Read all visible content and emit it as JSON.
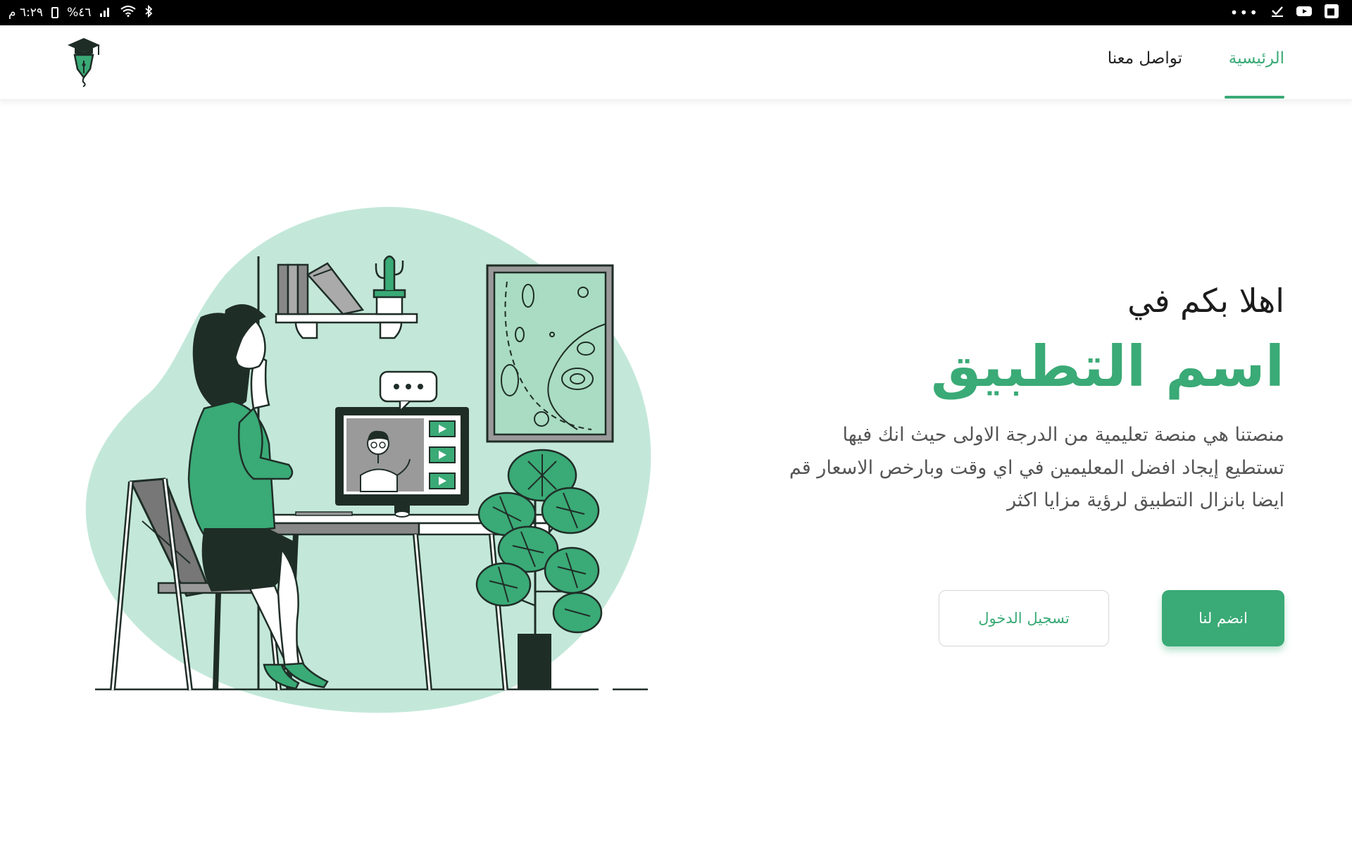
{
  "status_bar": {
    "time": "٦:٢٩ م",
    "battery": "%٤٦",
    "icons_left": [
      "battery-icon",
      "signal-icon",
      "wifi-icon",
      "bluetooth-icon"
    ],
    "icons_right": [
      "more-dots-icon",
      "check-icon",
      "youtube-icon",
      "app-icon"
    ]
  },
  "nav": {
    "home": "الرئيسية",
    "contact": "تواصل معنا",
    "active": "home"
  },
  "hero": {
    "greeting": "اهلا بكم في",
    "app_name": "اسم التطبيق",
    "description_lines": [
      "منصتنا هي منصة تعليمية من الدرجة الاولى حيث انك فيها",
      "تستطيع إيجاد افضل المعليمين في اي وقت وبارخص الاسعار قم",
      "ايضا بانزال التطبيق لرؤية مزايا اكثر"
    ]
  },
  "buttons": {
    "join": "انضم لنا",
    "login": "تسجيل الدخول"
  },
  "colors": {
    "accent": "#3aaa76",
    "blob": "#c3e8da",
    "dark": "#1f2d27"
  },
  "icons": {
    "logo": "graduation-cap-pen-logo-icon"
  }
}
